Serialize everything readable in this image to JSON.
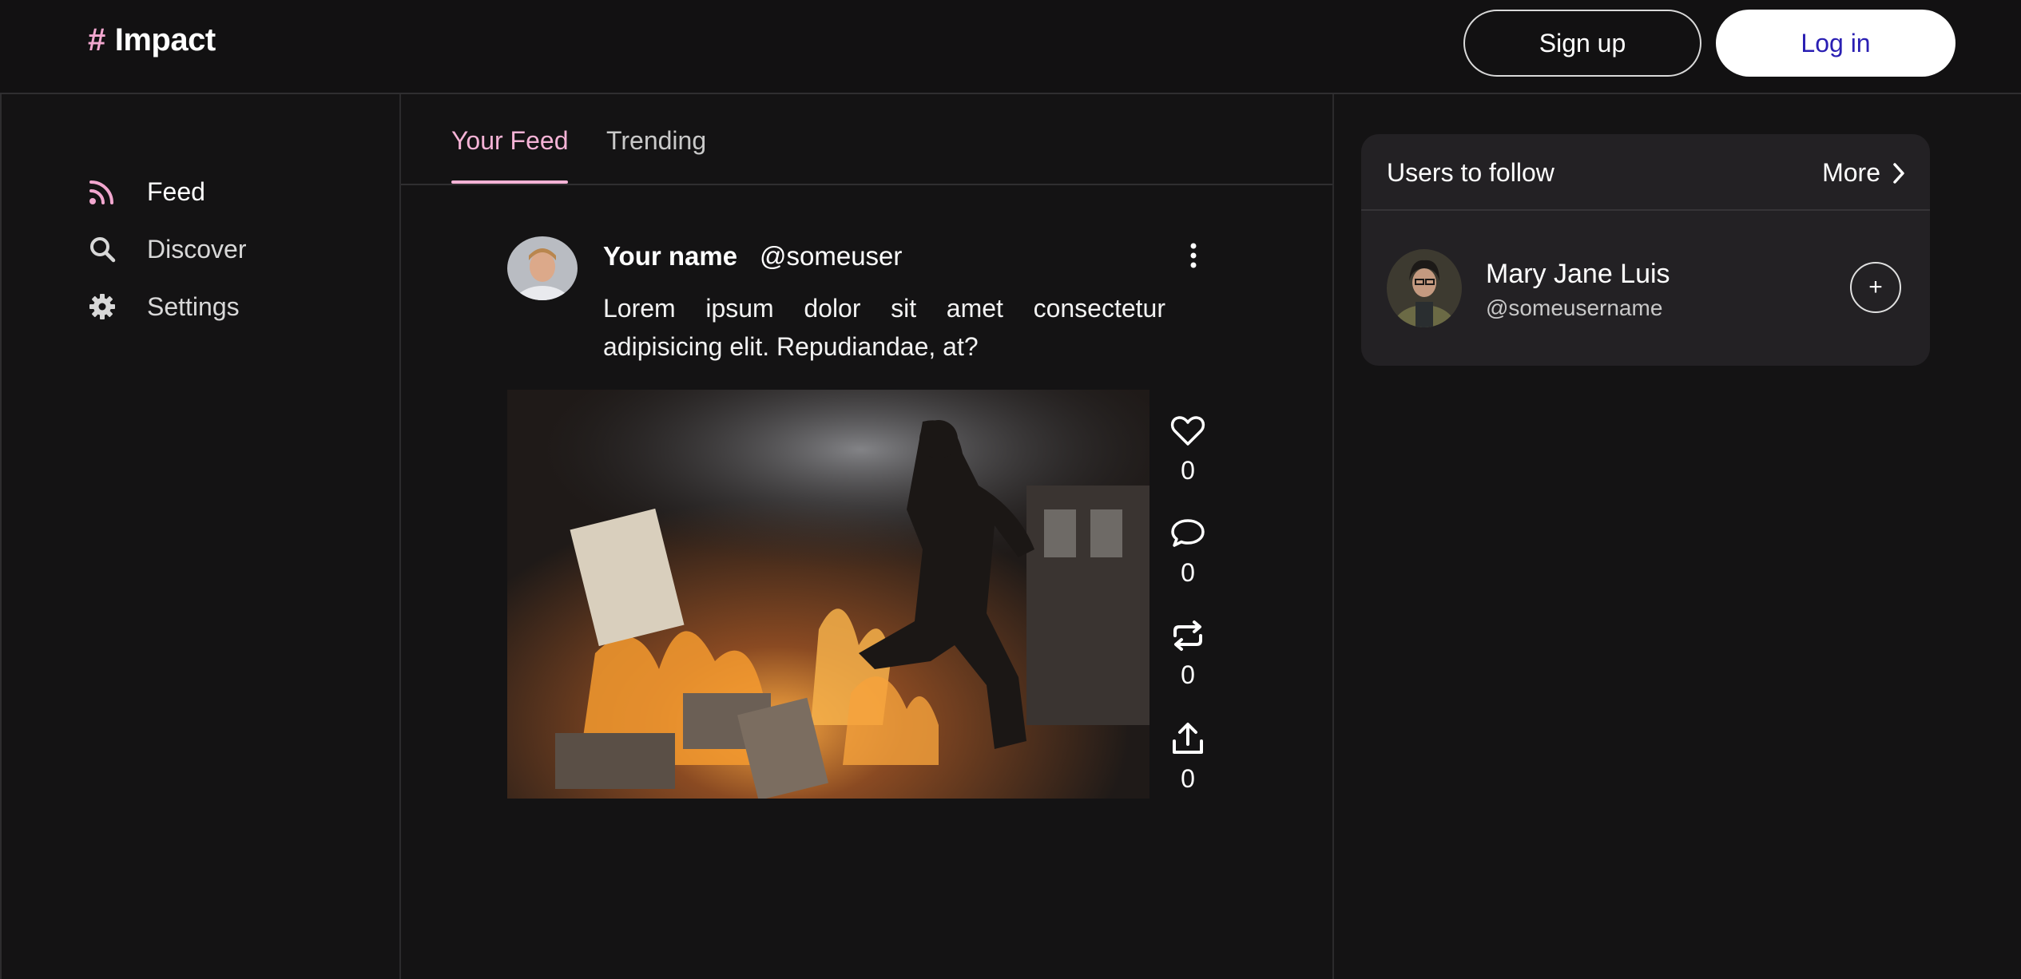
{
  "app": {
    "logo_symbol": "#",
    "logo_text": "Impact",
    "accent_color": "#f5b3d6"
  },
  "header": {
    "signup_label": "Sign up",
    "login_label": "Log in"
  },
  "sidebar": {
    "items": [
      {
        "label": "Feed",
        "icon": "rss-icon",
        "active": true
      },
      {
        "label": "Discover",
        "icon": "search-icon",
        "active": false
      },
      {
        "label": "Settings",
        "icon": "gear-icon",
        "active": false
      }
    ]
  },
  "tabs": [
    {
      "label": "Your Feed",
      "active": true
    },
    {
      "label": "Trending",
      "active": false
    }
  ],
  "post": {
    "author_name": "Your name",
    "author_handle": "@someuser",
    "text": "Lorem ipsum dolor sit amet consectetur adipisicing elit. Repudiandae, at?",
    "actions": [
      {
        "icon": "heart-icon",
        "count": "0"
      },
      {
        "icon": "comment-icon",
        "count": "0"
      },
      {
        "icon": "repost-icon",
        "count": "0"
      },
      {
        "icon": "share-icon",
        "count": "0"
      }
    ]
  },
  "follow_panel": {
    "title": "Users to follow",
    "more_label": "More",
    "users": [
      {
        "name": "Mary Jane Luis",
        "handle": "@someusername",
        "add_label": "+"
      }
    ]
  }
}
